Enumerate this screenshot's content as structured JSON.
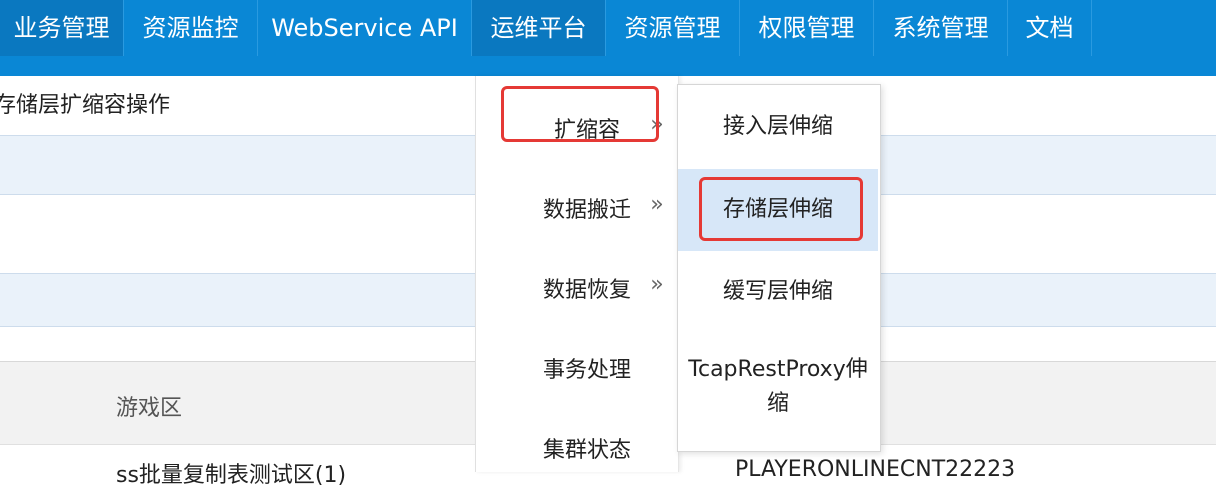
{
  "nav": {
    "items": [
      {
        "label": "业务管理"
      },
      {
        "label": "资源监控"
      },
      {
        "label": "WebService API"
      },
      {
        "label": "运维平台"
      },
      {
        "label": "资源管理"
      },
      {
        "label": "权限管理"
      },
      {
        "label": "系统管理"
      },
      {
        "label": "文档"
      }
    ]
  },
  "page": {
    "breadcrumb": "存储层扩缩容操作"
  },
  "table": {
    "header_game_zone": "游戏区",
    "row1_zone": "ss批量复制表测试区(1)",
    "row1_table": "PLAYERONLINECNT22223"
  },
  "menu": {
    "items": [
      {
        "label": "扩缩容",
        "chevron": "»"
      },
      {
        "label": "数据搬迁",
        "chevron": "»"
      },
      {
        "label": "数据恢复",
        "chevron": "»"
      },
      {
        "label": "事务处理"
      },
      {
        "label": "集群状态"
      }
    ]
  },
  "submenu": {
    "items": [
      {
        "label": "接入层伸缩"
      },
      {
        "label": "存储层伸缩"
      },
      {
        "label": "缓写层伸缩"
      },
      {
        "label": "TcapRestProxy伸缩"
      }
    ]
  },
  "colors": {
    "nav_bg": "#0a87d5",
    "highlight": "#e53935",
    "active_submenu_bg": "#d7e7f8"
  }
}
